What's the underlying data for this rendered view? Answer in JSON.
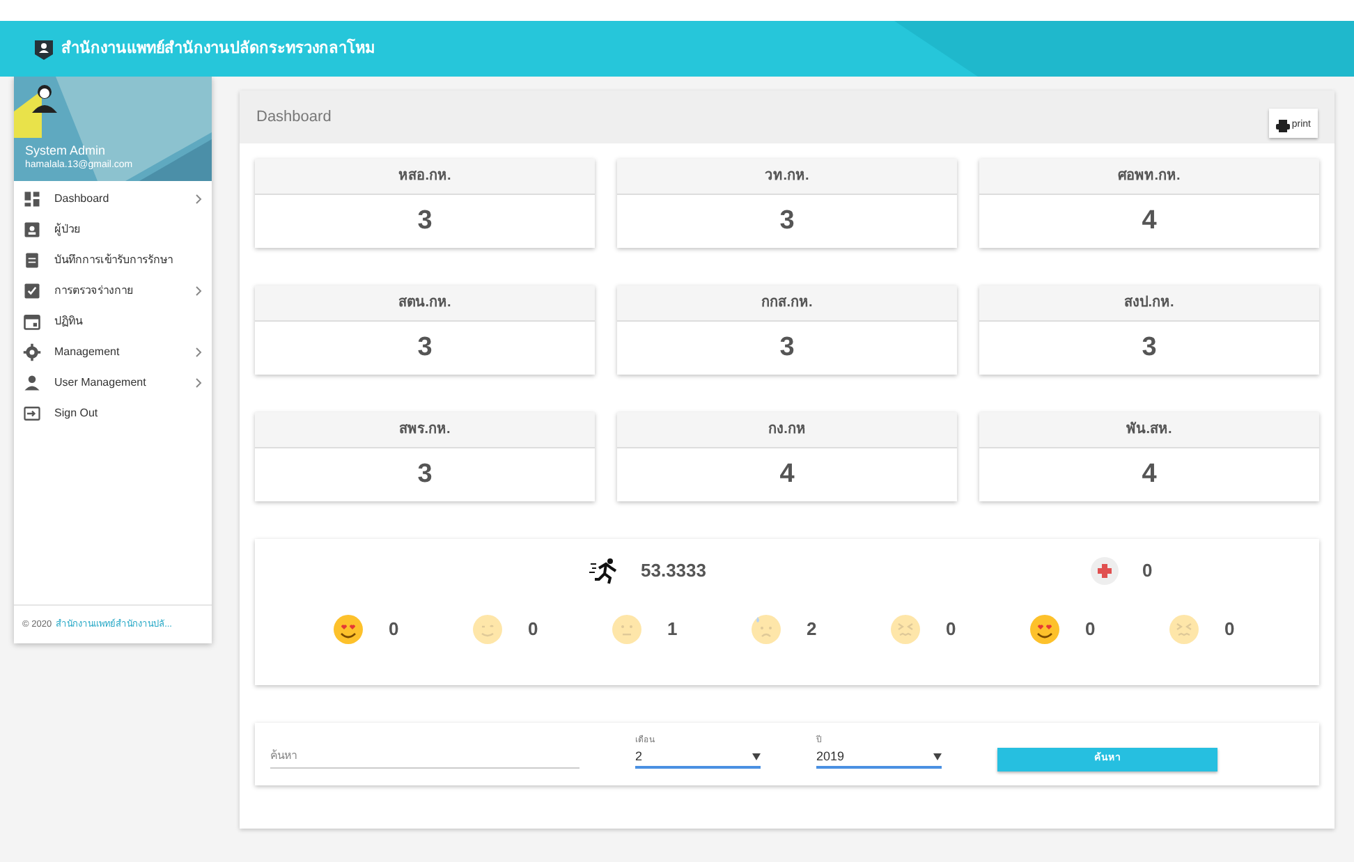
{
  "header": {
    "title": "สำนักงานแพทย์สำนักงานปลัดกระทรวงกลาโหม"
  },
  "sidebar": {
    "user": {
      "name": "System Admin",
      "email": "hamalala.13@gmail.com"
    },
    "items": [
      {
        "label": "Dashboard",
        "submenu": true
      },
      {
        "label": "ผู้ป่วย",
        "submenu": false
      },
      {
        "label": "บันทึกการเข้ารับการรักษา",
        "submenu": false
      },
      {
        "label": "การตรวจร่างกาย",
        "submenu": true
      },
      {
        "label": "ปฏิทิน",
        "submenu": false
      },
      {
        "label": "Management",
        "submenu": true
      },
      {
        "label": "User Management",
        "submenu": true
      },
      {
        "label": "Sign Out",
        "submenu": false
      }
    ],
    "footer": {
      "copyright": "© 2020",
      "link": "สำนักงานแพทย์สำนักงานปลั..."
    }
  },
  "panel": {
    "title": "Dashboard",
    "print_button": "print"
  },
  "cards": [
    {
      "title": "หสอ.กห.",
      "value": "3"
    },
    {
      "title": "วท.กห.",
      "value": "3"
    },
    {
      "title": "ศอพท.กห.",
      "value": "4"
    },
    {
      "title": "สตน.กห.",
      "value": "3"
    },
    {
      "title": "กกส.กห.",
      "value": "3"
    },
    {
      "title": "สงป.กห.",
      "value": "3"
    },
    {
      "title": "สพร.กห.",
      "value": "3"
    },
    {
      "title": "กง.กห",
      "value": "4"
    },
    {
      "title": "พัน.สห.",
      "value": "4"
    }
  ],
  "stats": {
    "fitness": "53.3333",
    "medical": "0",
    "moods_left": [
      {
        "kind": "love",
        "dimmed": false,
        "count": "0"
      },
      {
        "kind": "wink",
        "dimmed": true,
        "count": "0"
      },
      {
        "kind": "neutral",
        "dimmed": true,
        "count": "1"
      },
      {
        "kind": "sweat",
        "dimmed": true,
        "count": "2"
      },
      {
        "kind": "confounded",
        "dimmed": true,
        "count": "0"
      }
    ],
    "moods_right": [
      {
        "kind": "love",
        "dimmed": false,
        "count": "0"
      },
      {
        "kind": "confounded",
        "dimmed": true,
        "count": "0"
      }
    ]
  },
  "filter": {
    "search": {
      "placeholder": "ค้นหา"
    },
    "month": {
      "label": "เดือน",
      "value": "2"
    },
    "year": {
      "label": "ปี",
      "value": "2019"
    },
    "button": "ค้นหา"
  }
}
